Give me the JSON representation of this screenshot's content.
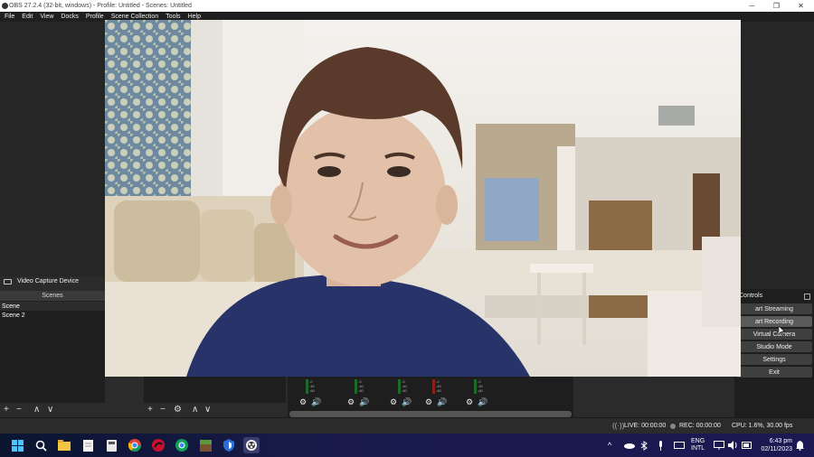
{
  "window": {
    "title": "OBS 27.2.4 (32-bit, windows) - Profile: Untitled - Scenes: Untitled",
    "minimize": "─",
    "maximize": "❐",
    "close": "✕"
  },
  "menu": [
    "File",
    "Edit",
    "View",
    "Docks",
    "Profile",
    "Scene Collection",
    "Tools",
    "Help"
  ],
  "source_bar": {
    "icon": "camera-icon",
    "label": "Video Capture Device"
  },
  "scenes": {
    "header": "Scenes",
    "items": [
      "Scene",
      "Scene 2"
    ],
    "toolbar": {
      "add": "+",
      "remove": "−",
      "up": "∧",
      "down": "∨"
    }
  },
  "sources": {
    "toolbar": {
      "add": "+",
      "remove": "−",
      "settings": "⚙",
      "up": "∧",
      "down": "∨"
    }
  },
  "mixer": {
    "meter_text": "-0\n-40\n-60",
    "gear": "⚙",
    "speaker": "🔊"
  },
  "controls": {
    "header": "Controls",
    "buttons": [
      "art Streaming",
      "art Recording",
      "Virtual Camera",
      "Studio Mode",
      "Settings",
      "Exit"
    ]
  },
  "status": {
    "live": "LIVE: 00:00:00",
    "rec": "REC: 00:00:00",
    "cpu": "CPU: 1.6%, 30.00 fps"
  },
  "taskbar": {
    "lang_top": "ENG",
    "lang_bottom": "INTL",
    "time": "6:43 pm",
    "date": "02/11/2023",
    "chevron": "^",
    "icons": [
      "windows-start-icon",
      "search-icon",
      "file-explorer-icon",
      "notepad-icon",
      "calculator-icon",
      "chrome-icon",
      "obs-red-icon",
      "chrome-beta-icon",
      "minecraft-icon",
      "shield-icon",
      "obs-studio-icon"
    ]
  },
  "colors": {
    "accent": "#5a5a5a",
    "panel": "#2b2b2b",
    "taskbar": "#1a1b4d"
  }
}
